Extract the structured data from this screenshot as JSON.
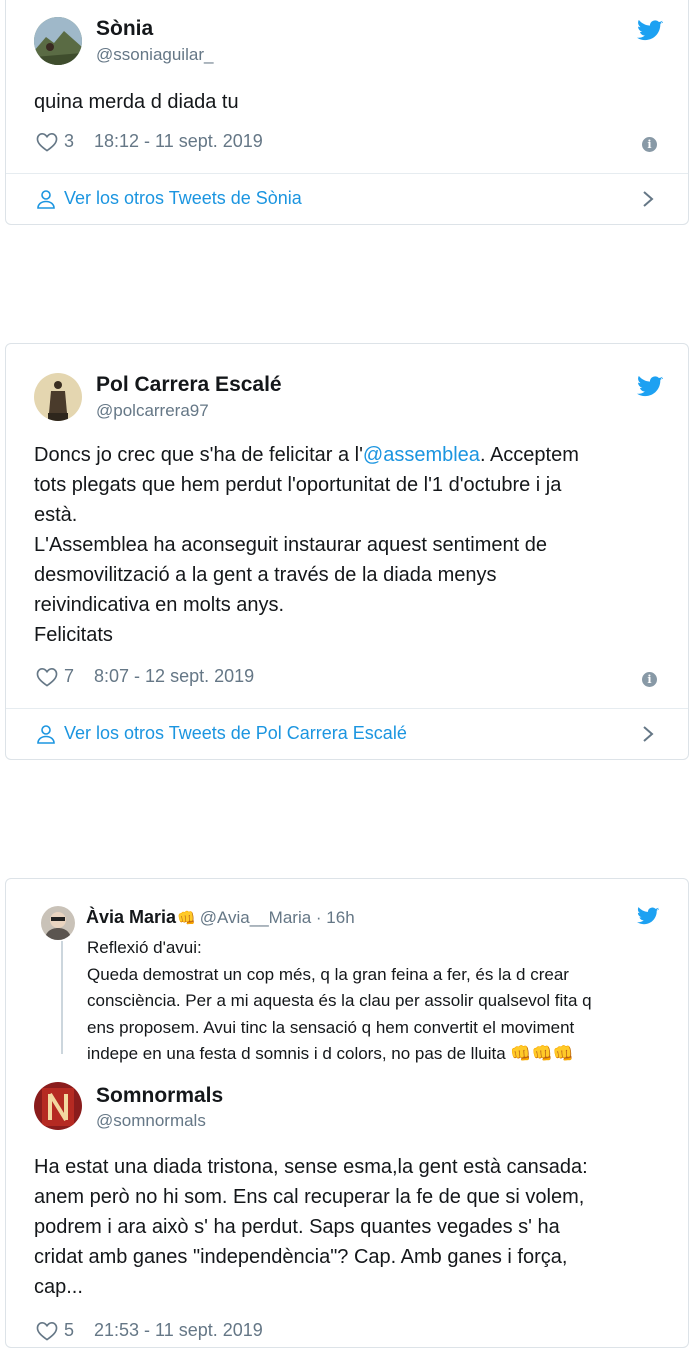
{
  "tweets": [
    {
      "name": "Sònia",
      "handle": "@ssoniaguilar_",
      "text": [
        "quina merda d diada tu"
      ],
      "likes": "3",
      "timestamp": "18:12 - 11 sept. 2019",
      "more_link": "Ver los otros Tweets de Sònia"
    },
    {
      "name": "Pol Carrera Escalé",
      "handle": "@polcarrera97",
      "text_line1_pre": "Doncs jo crec que s'ha de felicitar a l'",
      "text_line1_mention": "@assemblea",
      "text_line1_post": ". Acceptem",
      "text": [
        "tots plegats que hem perdut l'oportunitat de l'1 d'octubre i ja",
        "està.",
        "L'Assemblea ha aconseguit instaurar aquest sentiment de",
        "desmovilització a la gent a través de la diada menys",
        "reivindicativa en molts anys.",
        "Felicitats"
      ],
      "likes": "7",
      "timestamp": "8:07 - 12 sept. 2019",
      "more_link": "Ver los otros Tweets de Pol Carrera Escalé"
    },
    {
      "quoted": {
        "name": "Àvia Maria",
        "emoji": "👊",
        "handle_time": "@Avia__Maria · 16h",
        "text": [
          "Reflexió d'avui:",
          "Queda demostrat un cop més, q la gran feina a fer, és la d crear",
          "consciència. Per a mi aquesta és la clau per assolir qualsevol fita q",
          "ens proposem. Avui tinc la sensació q hem convertit el moviment",
          "indepe en una festa d somnis i d colors, no pas de lluita 👊👊👊"
        ]
      },
      "name": "Somnormals",
      "handle": "@somnormals",
      "text": [
        "Ha estat una diada tristona, sense esma,la gent està cansada:",
        "anem però no hi som. Ens cal recuperar la fe de que si volem,",
        "podrem i ara això s' ha perdut. Saps quantes vegades s' ha",
        "cridat amb ganes \"independència\"? Cap. Amb ganes i força,",
        "cap..."
      ],
      "likes": "5",
      "timestamp": "21:53 - 11 sept. 2019"
    }
  ],
  "icons": {
    "bird": "twitter-bird-icon",
    "heart": "heart-icon",
    "info": "info-icon",
    "person": "person-icon",
    "chevron": "chevron-right-icon"
  },
  "colors": {
    "link": "#1b95e0",
    "muted": "#657786",
    "border": "#dde3e8"
  }
}
